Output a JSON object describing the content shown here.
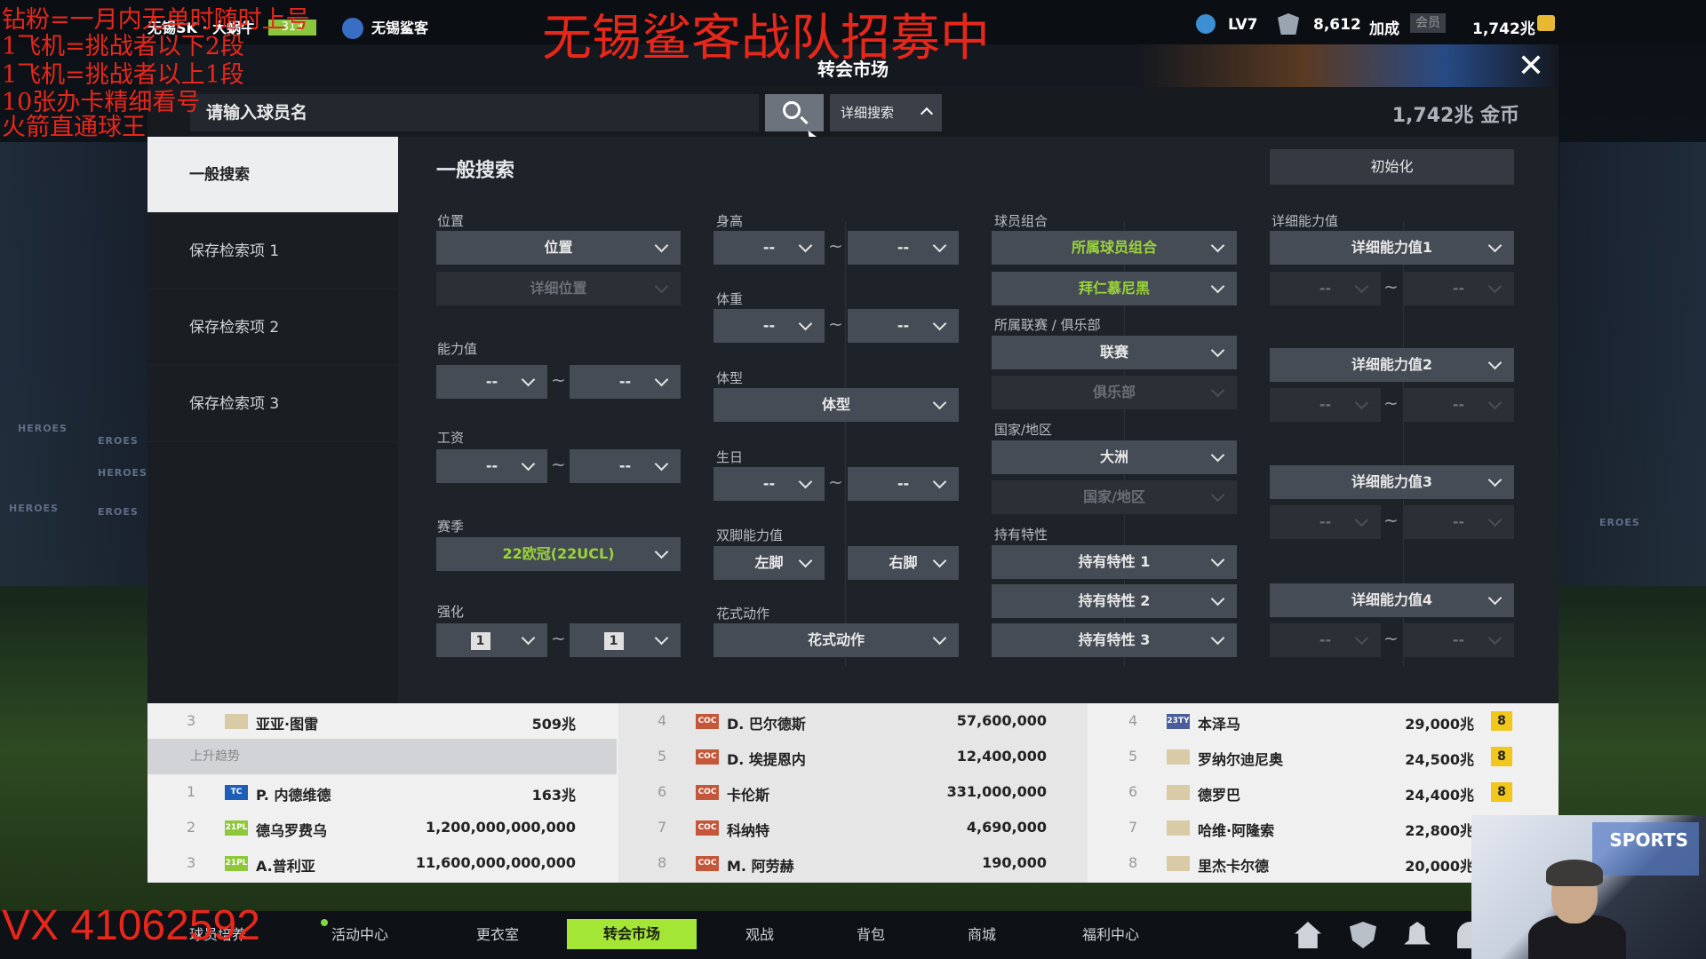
{
  "background": {
    "left_texts": [
      "HEROES",
      "EROES",
      "HEROES",
      "HEROES",
      "EROES"
    ],
    "right_texts": [
      "EROES"
    ]
  },
  "topbar": {
    "team_text": "无锡SK · 大蜗牛",
    "rank": "313",
    "team_label": "无锡鲨客",
    "level": "LV7",
    "points": "8,612",
    "bonus": "加成",
    "member": "会员",
    "coins": "1,742兆"
  },
  "stream": {
    "headline": "无锡鲨客战队招募中",
    "lines": [
      "钻粉=一月内无单时随时上号",
      "1飞机=挑战者以下2段",
      "1飞机=挑战者以上1段",
      "10张办卡精细看号",
      "火箭直通球王"
    ],
    "vx": "VX 41062592"
  },
  "title": "转会市场",
  "search": {
    "placeholder": "请输入球员名",
    "detail_btn": "详细搜索",
    "coins": "1,742兆 金币"
  },
  "sidebar": {
    "items": [
      {
        "label": "一般搜索"
      },
      {
        "label": "保存检索项 1"
      },
      {
        "label": "保存检索项 2"
      },
      {
        "label": "保存检索项 3"
      }
    ]
  },
  "panel": {
    "title": "一般搜索",
    "reset": "初始化"
  },
  "filters": {
    "position_label": "位置",
    "position": "位置",
    "detail_position": "详细位置",
    "ability_label": "能力值",
    "ability_min": "--",
    "ability_max": "--",
    "salary_label": "工资",
    "salary_min": "--",
    "salary_max": "--",
    "season_label": "赛季",
    "season": "22欧冠(22UCL)",
    "enhance_label": "强化",
    "enhance_min": "1",
    "enhance_max": "1",
    "height_label": "身高",
    "height_min": "--",
    "height_max": "--",
    "weight_label": "体重",
    "weight_min": "--",
    "weight_max": "--",
    "body_label": "体型",
    "body": "体型",
    "birth_label": "生日",
    "birth_min": "--",
    "birth_max": "--",
    "foot_label": "双脚能力值",
    "left_foot": "左脚",
    "right_foot": "右脚",
    "skill_label": "花式动作",
    "skill": "花式动作",
    "combo_label": "球员组合",
    "combo": "所属球员组合",
    "club_combo": "拜仁慕尼黑",
    "league_label": "所属联赛 / 俱乐部",
    "league": "联赛",
    "club": "俱乐部",
    "nation_label": "国家/地区",
    "continent": "大洲",
    "nation": "国家/地区",
    "trait_label": "持有特性",
    "trait1": "持有特性 1",
    "trait2": "持有特性 2",
    "trait3": "持有特性 3",
    "detail_label": "详细能力值",
    "detail1": "详细能力值1",
    "detail2": "详细能力值2",
    "detail3": "详细能力值3",
    "detail4": "详细能力值4",
    "dash": "--"
  },
  "table": {
    "col1": {
      "row1": {
        "rank": "3",
        "name": "亚亚·图雷",
        "price": "509兆"
      },
      "trend": "上升趋势",
      "rows": [
        {
          "rank": "1",
          "icon": "TC",
          "name": "P. 内德维德",
          "price": "163兆"
        },
        {
          "rank": "2",
          "icon": "21PL",
          "name": "德乌罗费乌",
          "price": "1,200,000,000,000"
        },
        {
          "rank": "3",
          "icon": "21PL",
          "name": "A.普利亚",
          "price": "11,600,000,000,000"
        }
      ]
    },
    "col2": {
      "rows": [
        {
          "rank": "4",
          "icon": "COC",
          "name": "D. 巴尔德斯",
          "price": "57,600,000"
        },
        {
          "rank": "5",
          "icon": "COC",
          "name": "D. 埃提恩内",
          "price": "12,400,000"
        },
        {
          "rank": "6",
          "icon": "COC",
          "name": "卡伦斯",
          "price": "331,000,000"
        },
        {
          "rank": "7",
          "icon": "COC",
          "name": "科纳特",
          "price": "4,690,000"
        },
        {
          "rank": "8",
          "icon": "COC",
          "name": "M. 阿劳赫",
          "price": "190,000"
        }
      ]
    },
    "col3": {
      "rows": [
        {
          "rank": "4",
          "icon": "23TY",
          "name": "本泽马",
          "price": "29,000兆",
          "enh": "8"
        },
        {
          "rank": "5",
          "icon": "",
          "name": "罗纳尔迪尼奥",
          "price": "24,500兆",
          "enh": "8"
        },
        {
          "rank": "6",
          "icon": "",
          "name": "德罗巴",
          "price": "24,400兆",
          "enh": "8"
        },
        {
          "rank": "7",
          "icon": "",
          "name": "哈维·阿隆索",
          "price": "22,800兆"
        },
        {
          "rank": "8",
          "icon": "",
          "name": "里杰卡尔德",
          "price": "20,000兆"
        }
      ]
    }
  },
  "bottom_nav": [
    {
      "label": "球员培养"
    },
    {
      "label": "活动中心"
    },
    {
      "label": "更衣室"
    },
    {
      "label": "转会市场"
    },
    {
      "label": "观战"
    },
    {
      "label": "背包"
    },
    {
      "label": "商城"
    },
    {
      "label": "福利中心"
    }
  ],
  "webcam": {
    "sign": "SPORTS"
  }
}
